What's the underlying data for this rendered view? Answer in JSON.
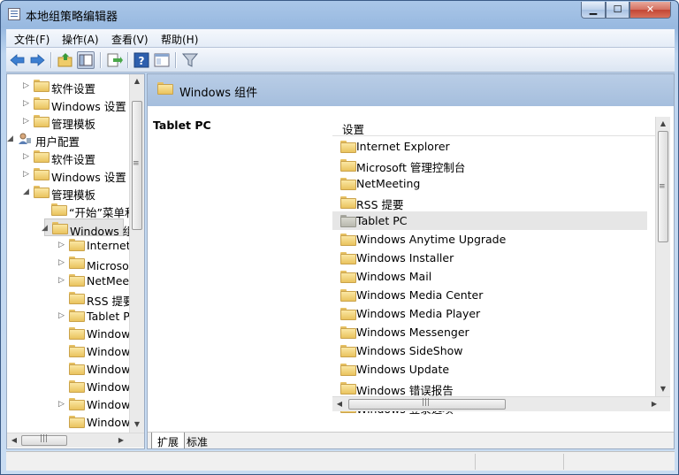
{
  "window": {
    "title": "本地组策略编辑器"
  },
  "menubar": {
    "items": [
      "文件(F)",
      "操作(A)",
      "查看(V)",
      "帮助(H)"
    ]
  },
  "toolbar": {
    "buttons": [
      "back-icon",
      "forward-icon",
      "up-folder-icon",
      "show-hide-tree-icon",
      "export-list-icon",
      "help-icon",
      "properties-view-icon",
      "filter-icon"
    ]
  },
  "tree": {
    "rows": [
      {
        "label": "软件设置",
        "level": 1,
        "expander": "collapsed"
      },
      {
        "label": "Windows 设置",
        "level": 1,
        "expander": "collapsed"
      },
      {
        "label": "管理模板",
        "level": 1,
        "expander": "collapsed"
      },
      {
        "label": "用户配置",
        "level": 0,
        "expander": "expanded",
        "icon": "user-config-icon"
      },
      {
        "label": "软件设置",
        "level": 1,
        "expander": "collapsed"
      },
      {
        "label": "Windows 设置",
        "level": 1,
        "expander": "collapsed"
      },
      {
        "label": "管理模板",
        "level": 1,
        "expander": "expanded"
      },
      {
        "label": "“开始”菜单和任务栏",
        "level": 2,
        "expander": "none"
      },
      {
        "label": "Windows 组件",
        "level": 2,
        "expander": "expanded",
        "selected": true
      },
      {
        "label": "Internet Explorer",
        "level": 3,
        "expander": "collapsed"
      },
      {
        "label": "Microsoft 管理控制台",
        "level": 3,
        "expander": "collapsed"
      },
      {
        "label": "NetMeeting",
        "level": 3,
        "expander": "collapsed"
      },
      {
        "label": "RSS 提要",
        "level": 3,
        "expander": "none"
      },
      {
        "label": "Tablet PC",
        "level": 3,
        "expander": "collapsed"
      },
      {
        "label": "Windows Anytime Upgrade",
        "level": 3,
        "expander": "none"
      },
      {
        "label": "Windows Installer",
        "level": 3,
        "expander": "none"
      },
      {
        "label": "Windows Mail",
        "level": 3,
        "expander": "none"
      },
      {
        "label": "Windows Media Center",
        "level": 3,
        "expander": "none"
      },
      {
        "label": "Windows Media Player",
        "level": 3,
        "expander": "collapsed"
      },
      {
        "label": "Windows Messenger",
        "level": 3,
        "expander": "none"
      }
    ]
  },
  "details": {
    "banner_title": "Windows 组件",
    "selected_item_title": "Tablet PC",
    "column_header": "设置",
    "items": [
      {
        "label": "Internet Explorer"
      },
      {
        "label": "Microsoft 管理控制台"
      },
      {
        "label": "NetMeeting"
      },
      {
        "label": "RSS 提要"
      },
      {
        "label": "Tablet PC",
        "selected": true,
        "icon": "gray-folder"
      },
      {
        "label": "Windows Anytime Upgrade"
      },
      {
        "label": "Windows Installer"
      },
      {
        "label": "Windows Mail"
      },
      {
        "label": "Windows Media Center"
      },
      {
        "label": "Windows Media Player"
      },
      {
        "label": "Windows Messenger"
      },
      {
        "label": "Windows SideShow"
      },
      {
        "label": "Windows Update"
      },
      {
        "label": "Windows 错误报告"
      },
      {
        "label": "Windows 登录选项"
      }
    ]
  },
  "tabs": {
    "items": [
      "扩展",
      "标准"
    ],
    "active": "扩展"
  }
}
